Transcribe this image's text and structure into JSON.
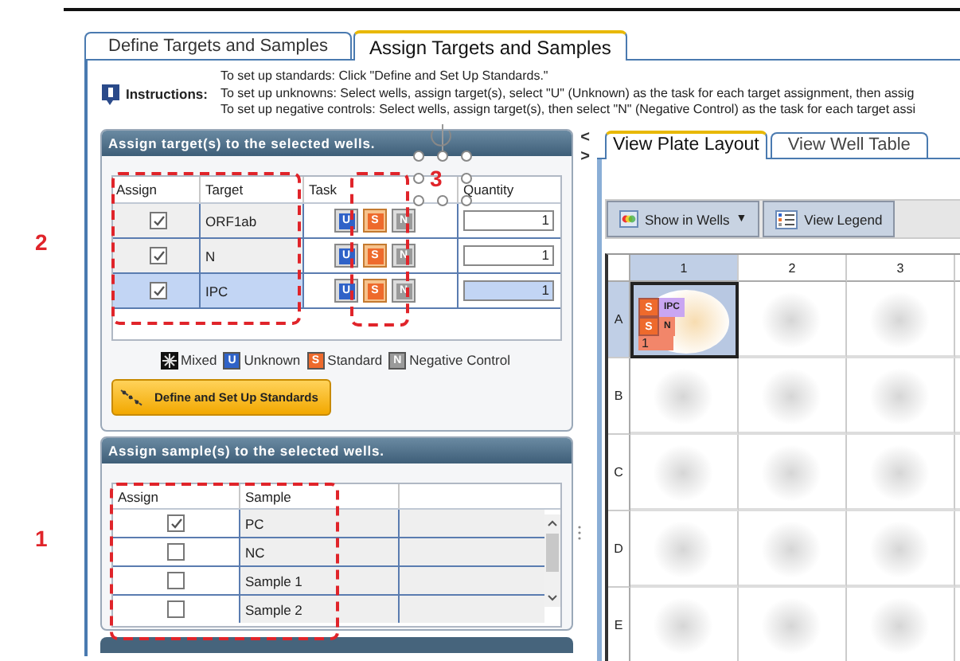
{
  "tabs": [
    {
      "label": "Define Targets and Samples",
      "selected": false
    },
    {
      "label": "Assign Targets and Samples",
      "selected": true
    }
  ],
  "instructions": {
    "label": "Instructions:",
    "lines": [
      "To set up standards: Click \"Define and Set Up Standards.\"",
      "To set up unknowns: Select wells, assign target(s), select \"U\" (Unknown) as the task for each target assignment, then assig",
      "To set up negative controls: Select wells, assign target(s), then select \"N\" (Negative Control) as the task for each target assi"
    ]
  },
  "targets_panel": {
    "title": "Assign target(s) to the selected wells.",
    "columns": [
      "Assign",
      "Target",
      "Task",
      "Quantity"
    ],
    "rows": [
      {
        "assigned": true,
        "target": "ORF1ab",
        "selected": false,
        "quantity": "1",
        "tasks": [
          {
            "kind": "unknown",
            "letter": "U",
            "selected": false
          },
          {
            "kind": "standard",
            "letter": "S",
            "selected": true
          },
          {
            "kind": "negative",
            "letter": "N",
            "selected": false
          }
        ]
      },
      {
        "assigned": true,
        "target": "N",
        "selected": false,
        "quantity": "1",
        "tasks": [
          {
            "kind": "unknown",
            "letter": "U",
            "selected": false
          },
          {
            "kind": "standard",
            "letter": "S",
            "selected": true
          },
          {
            "kind": "negative",
            "letter": "N",
            "selected": false
          }
        ]
      },
      {
        "assigned": true,
        "target": "IPC",
        "selected": true,
        "quantity": "1",
        "tasks": [
          {
            "kind": "unknown",
            "letter": "U",
            "selected": false
          },
          {
            "kind": "standard",
            "letter": "S",
            "selected": true
          },
          {
            "kind": "negative",
            "letter": "N",
            "selected": false
          }
        ]
      }
    ],
    "legend": [
      {
        "kind": "mixed",
        "label": "Mixed"
      },
      {
        "kind": "unknown",
        "letter": "U",
        "label": "Unknown"
      },
      {
        "kind": "standard",
        "letter": "S",
        "label": "Standard"
      },
      {
        "kind": "negative",
        "letter": "N",
        "label": "Negative Control"
      }
    ],
    "button": "Define and Set Up Standards"
  },
  "samples_panel": {
    "title": "Assign sample(s) to the selected wells.",
    "columns": [
      "Assign",
      "Sample"
    ],
    "rows": [
      {
        "assigned": true,
        "sample": "PC"
      },
      {
        "assigned": false,
        "sample": "NC"
      },
      {
        "assigned": false,
        "sample": "Sample 1"
      },
      {
        "assigned": false,
        "sample": "Sample 2"
      }
    ]
  },
  "view_tabs": [
    {
      "label": "View Plate Layout",
      "selected": true
    },
    {
      "label": "View Well Table",
      "selected": false
    }
  ],
  "toolbar": [
    {
      "kind": "menu",
      "label": "Show in Wells",
      "caret": "▼"
    },
    {
      "kind": "legend",
      "label": "View Legend"
    }
  ],
  "plate": {
    "columns": [
      "1",
      "2",
      "3"
    ],
    "rows": [
      {
        "label": "A",
        "wells": [
          {
            "selected": true,
            "quantity": "1",
            "targets": [
              {
                "letter": "S",
                "name": "IPC",
                "color": "#c9a6f2"
              },
              {
                "letter": "S",
                "name": "N",
                "color": "#f2866a"
              }
            ]
          },
          {
            "selected": false
          },
          {
            "selected": false
          }
        ]
      },
      {
        "label": "B",
        "wells": [
          {
            "selected": false
          },
          {
            "selected": false
          },
          {
            "selected": false
          }
        ]
      },
      {
        "label": "C",
        "wells": [
          {
            "selected": false
          },
          {
            "selected": false
          },
          {
            "selected": false
          }
        ]
      },
      {
        "label": "D",
        "wells": [
          {
            "selected": false
          },
          {
            "selected": false
          },
          {
            "selected": false
          }
        ]
      },
      {
        "label": "E",
        "wells": [
          {
            "selected": false
          },
          {
            "selected": false
          },
          {
            "selected": false
          }
        ]
      }
    ]
  },
  "pane_arrows": [
    "<",
    ">"
  ],
  "callouts": [
    {
      "label": "2",
      "kind": "targets"
    },
    {
      "label": "3",
      "kind": "tasks"
    },
    {
      "label": "1",
      "kind": "samples"
    }
  ]
}
